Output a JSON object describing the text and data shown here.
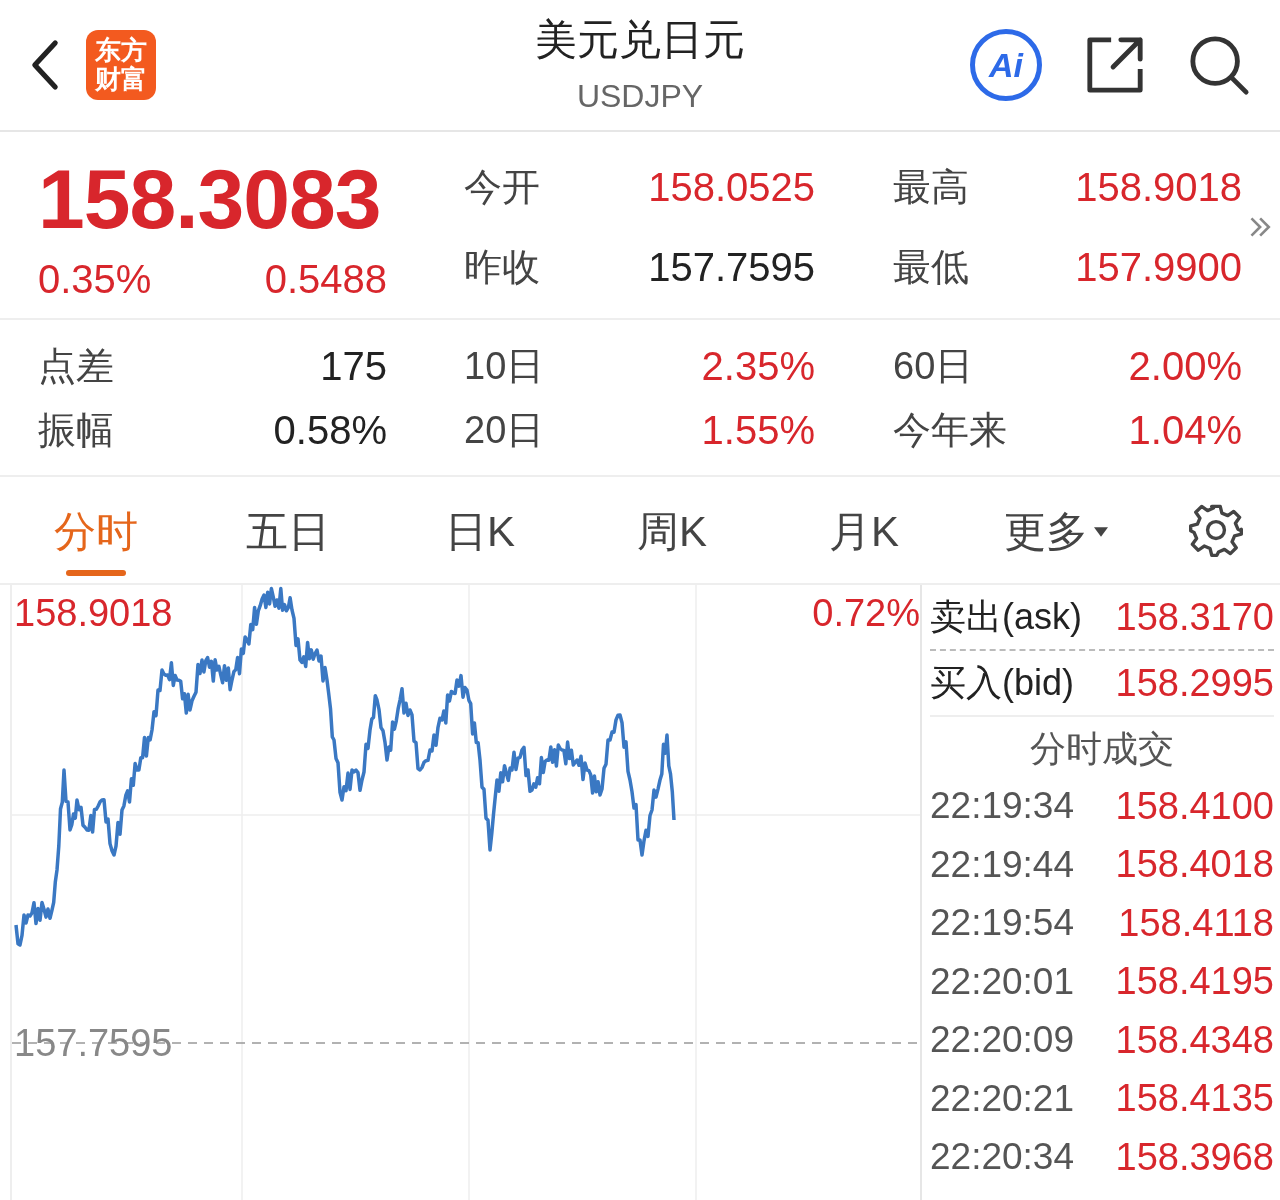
{
  "header": {
    "logo": "东方财富",
    "title": "美元兑日元",
    "subtitle": "USDJPY",
    "ai_label": "Ai"
  },
  "quote": {
    "price": "158.3083",
    "change_percent": "0.35%",
    "change": "0.5488",
    "color": "#d8262c",
    "details": [
      {
        "label": "今开",
        "value": "158.0525",
        "color": "#d8262c"
      },
      {
        "label": "最高",
        "value": "158.9018",
        "color": "#d8262c"
      },
      {
        "label": "昨收",
        "value": "157.7595",
        "color": "#222222"
      },
      {
        "label": "最低",
        "value": "157.9900",
        "color": "#d8262c"
      }
    ]
  },
  "stats": [
    {
      "label": "点差",
      "value": "175",
      "color": "#222222"
    },
    {
      "label": "10日",
      "value": "2.35%",
      "color": "#d8262c"
    },
    {
      "label": "60日",
      "value": "2.00%",
      "color": "#d8262c"
    },
    {
      "label": "振幅",
      "value": "0.58%",
      "color": "#222222"
    },
    {
      "label": "20日",
      "value": "1.55%",
      "color": "#d8262c"
    },
    {
      "label": "今年来",
      "value": "1.04%",
      "color": "#d8262c"
    }
  ],
  "tabs": [
    {
      "label": "分时",
      "selected": true,
      "kind": "tab"
    },
    {
      "label": "五日",
      "selected": false,
      "kind": "tab"
    },
    {
      "label": "日K",
      "selected": false,
      "kind": "tab"
    },
    {
      "label": "周K",
      "selected": false,
      "kind": "tab"
    },
    {
      "label": "月K",
      "selected": false,
      "kind": "tab"
    },
    {
      "label": "更多",
      "selected": false,
      "kind": "menu"
    }
  ],
  "chart": {
    "high_label": "158.9018",
    "percent_label": "0.72%",
    "base_label": "157.7595"
  },
  "order_panel": {
    "ask": {
      "label": "卖出(ask)",
      "value": "158.3170"
    },
    "bid": {
      "label": "买入(bid)",
      "value": "158.2995"
    },
    "trades_title": "分时成交",
    "trades": [
      {
        "time": "22:19:34",
        "price": "158.4100"
      },
      {
        "time": "22:19:44",
        "price": "158.4018"
      },
      {
        "time": "22:19:54",
        "price": "158.4118"
      },
      {
        "time": "22:20:01",
        "price": "158.4195"
      },
      {
        "time": "22:20:09",
        "price": "158.4348"
      },
      {
        "time": "22:20:21",
        "price": "158.4135"
      },
      {
        "time": "22:20:34",
        "price": "158.3968"
      }
    ]
  }
}
